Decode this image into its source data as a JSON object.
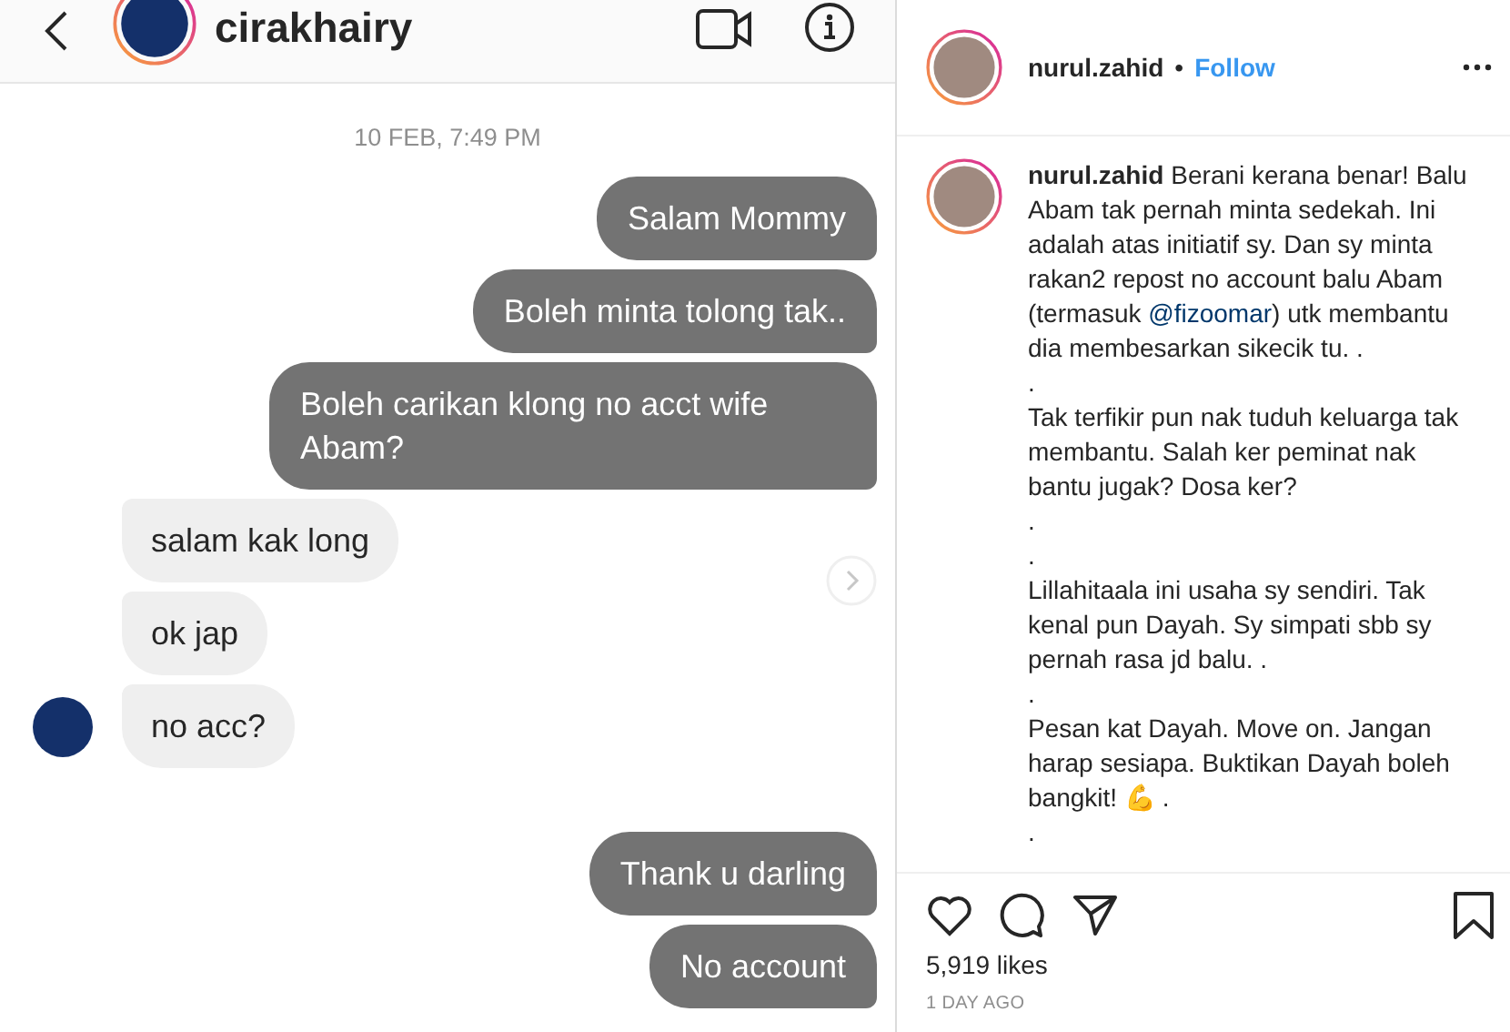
{
  "chat": {
    "username": "cirakhairy",
    "date": "10 FEB, 7:49 PM",
    "messages": [
      {
        "kind": "sent",
        "text": "Salam Mommy"
      },
      {
        "kind": "sent",
        "text": "Boleh minta tolong tak.."
      },
      {
        "kind": "sent",
        "text": "Boleh carikan klong no acct wife Abam?"
      },
      {
        "kind": "received",
        "text": "salam kak long"
      },
      {
        "kind": "received",
        "text": "ok jap"
      },
      {
        "kind": "received",
        "text": "no acc?"
      },
      {
        "kind": "sent",
        "text": "Thank u darling"
      },
      {
        "kind": "sent",
        "text": "No account"
      }
    ]
  },
  "post": {
    "username": "nurul.zahid",
    "separator": "•",
    "follow": "Follow",
    "caption": {
      "username": "nurul.zahid",
      "paragraphs": [
        [
          {
            "kind": "text",
            "text": "Berani kerana benar! Balu Abam tak pernah minta sedekah. Ini adalah atas initiatif sy. Dan sy minta rakan2 repost no account balu Abam (termasuk "
          },
          {
            "kind": "mention",
            "text": "@fizoomar"
          },
          {
            "kind": "text",
            "text": ") utk membantu dia membesarkan sikecik tu. ."
          }
        ],
        [
          {
            "kind": "text",
            "text": "."
          }
        ],
        [
          {
            "kind": "text",
            "text": "Tak terfikir pun nak tuduh keluarga tak membantu. Salah ker peminat nak bantu jugak? Dosa ker?"
          }
        ],
        [
          {
            "kind": "text",
            "text": "."
          }
        ],
        [
          {
            "kind": "text",
            "text": "."
          }
        ],
        [
          {
            "kind": "text",
            "text": "Lillahitaala ini usaha sy sendiri. Tak kenal pun Dayah. Sy simpati sbb sy pernah rasa jd balu. ."
          }
        ],
        [
          {
            "kind": "text",
            "text": "."
          }
        ],
        [
          {
            "kind": "text",
            "text": "Pesan kat Dayah. Move on. Jangan harap sesiapa. Buktikan Dayah boleh bangkit! "
          },
          {
            "kind": "emoji",
            "text": "💪"
          },
          {
            "kind": "text",
            "text": " ."
          }
        ],
        [
          {
            "kind": "text",
            "text": "."
          }
        ]
      ]
    },
    "likes": "5,919 likes",
    "time": "1 DAY AGO"
  }
}
